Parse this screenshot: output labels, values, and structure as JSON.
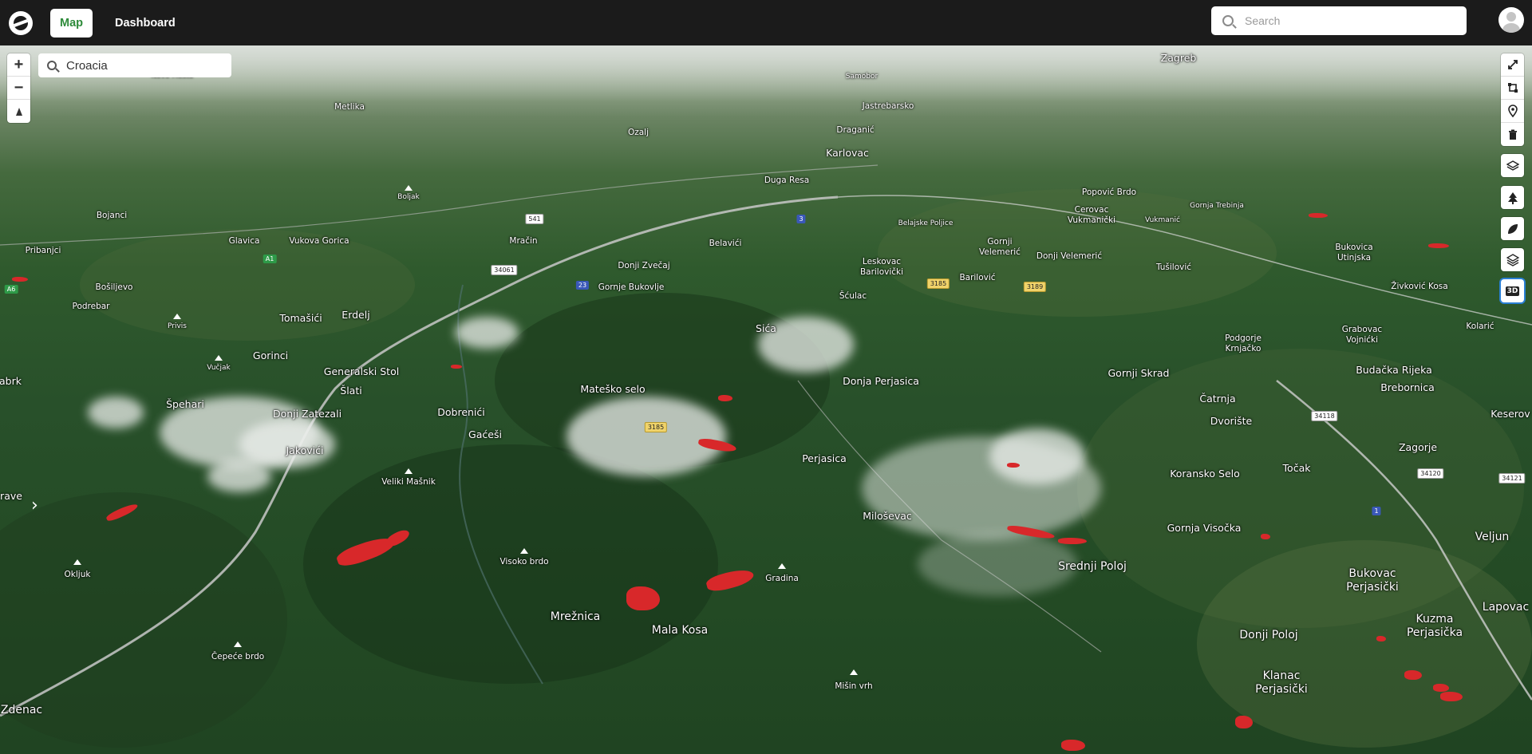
{
  "header": {
    "logo": "app-logo",
    "tabs": [
      {
        "label": "Map",
        "active": true
      },
      {
        "label": "Dashboard",
        "active": false
      }
    ],
    "search_placeholder": "Search"
  },
  "map": {
    "search_value": "Croacia",
    "controls": {
      "zoom_in": "+",
      "zoom_out": "−",
      "expand": "›",
      "three_d": "3D"
    },
    "toolbar_icons": [
      "expand-diagonal-icon",
      "polygon-draw-icon",
      "location-pin-icon",
      "trash-icon",
      "layers-icon",
      "tree-icon",
      "leaf-icon",
      "layers-stack-icon",
      "three-d-icon"
    ],
    "accent_color": "#2e8b3a",
    "fire_color": "#d8282a",
    "places": [
      {
        "name": "Zagreb",
        "size": "m"
      },
      {
        "name": "Karlovac",
        "size": "m"
      },
      {
        "name": "Duga Resa",
        "size": "s"
      },
      {
        "name": "Metlika",
        "size": "s"
      },
      {
        "name": "Novo Mesto",
        "size": "xs"
      },
      {
        "name": "Ozalj",
        "size": "s"
      },
      {
        "name": "Draganić",
        "size": "s"
      },
      {
        "name": "Jastrebarsko",
        "size": "s"
      },
      {
        "name": "Samobor",
        "size": "xs"
      },
      {
        "name": "Mrežnica",
        "size": "l"
      },
      {
        "name": "Mala Kosa",
        "size": "l"
      },
      {
        "name": "Srednji Poloj",
        "size": "l"
      },
      {
        "name": "Bukovac Perjasički",
        "size": "l"
      },
      {
        "name": "Kuzma Perjasička",
        "size": "l"
      },
      {
        "name": "Klanac Perjasički",
        "size": "l"
      },
      {
        "name": "Donji Poloj",
        "size": "l"
      },
      {
        "name": "Lapovac",
        "size": "l"
      },
      {
        "name": "Veljun",
        "size": "l"
      },
      {
        "name": "Gornja Visočka",
        "size": "m"
      },
      {
        "name": "Koransko Selo",
        "size": "m"
      },
      {
        "name": "Točak",
        "size": "m"
      },
      {
        "name": "Zagorje",
        "size": "m"
      },
      {
        "name": "Keserov",
        "size": "m"
      },
      {
        "name": "Dvorište",
        "size": "m"
      },
      {
        "name": "Čatrnja",
        "size": "m"
      },
      {
        "name": "Gornji Skrad",
        "size": "m"
      },
      {
        "name": "Budačka Rijeka",
        "size": "m"
      },
      {
        "name": "Brebornica",
        "size": "m"
      },
      {
        "name": "Perjasica",
        "size": "m"
      },
      {
        "name": "Miloševac",
        "size": "m"
      },
      {
        "name": "Donja Perjasica",
        "size": "m"
      },
      {
        "name": "Sića",
        "size": "m"
      },
      {
        "name": "Mateško selo",
        "size": "m"
      },
      {
        "name": "Dobrenići",
        "size": "m"
      },
      {
        "name": "Gaćeši",
        "size": "m"
      },
      {
        "name": "Generalski Stol",
        "size": "m"
      },
      {
        "name": "Šlati",
        "size": "m"
      },
      {
        "name": "Gorinci",
        "size": "m"
      },
      {
        "name": "Špehari",
        "size": "m"
      },
      {
        "name": "Donji Zatezali",
        "size": "m"
      },
      {
        "name": "Jakovići",
        "size": "m"
      },
      {
        "name": "Tomašići",
        "size": "m"
      },
      {
        "name": "Erdelj",
        "size": "m"
      },
      {
        "name": "Gornje Bukovlje",
        "size": "s"
      },
      {
        "name": "Donji Zvečaj",
        "size": "s"
      },
      {
        "name": "Belavići",
        "size": "s"
      },
      {
        "name": "Mračin",
        "size": "s"
      },
      {
        "name": "Glavica",
        "size": "s"
      },
      {
        "name": "Vukova Gorica",
        "size": "s"
      },
      {
        "name": "Bošiljevo",
        "size": "s"
      },
      {
        "name": "Podrebar",
        "size": "s"
      },
      {
        "name": "Pribanjci",
        "size": "s"
      },
      {
        "name": "Bojanci",
        "size": "s"
      },
      {
        "name": "Leskovac Barilovički",
        "size": "s"
      },
      {
        "name": "Barilović",
        "size": "s"
      },
      {
        "name": "Šćulac",
        "size": "s"
      },
      {
        "name": "Gornji Velemerić",
        "size": "s"
      },
      {
        "name": "Donji Velemerić",
        "size": "s"
      },
      {
        "name": "Cerovac Vukmanički",
        "size": "s"
      },
      {
        "name": "Tušilović",
        "size": "s"
      },
      {
        "name": "Podgorje Krnjačko",
        "size": "s"
      },
      {
        "name": "Grabovac Vojnićki",
        "size": "s"
      },
      {
        "name": "Kolarić",
        "size": "s"
      },
      {
        "name": "Bukovica Utinjska",
        "size": "s"
      },
      {
        "name": "Živković Kosa",
        "size": "s"
      },
      {
        "name": "Popović Brdo",
        "size": "s"
      },
      {
        "name": "Gornja Trebinja",
        "size": "xs"
      },
      {
        "name": "Vukmanić",
        "size": "xs"
      },
      {
        "name": "Belajske Poljice",
        "size": "xs"
      },
      {
        "name": "Zdenac",
        "size": "l"
      },
      {
        "name": "rave",
        "size": "m"
      },
      {
        "name": "abrk",
        "size": "m"
      }
    ],
    "peaks": [
      "Veliki Mašnik",
      "Visoko brdo",
      "Gradina",
      "Mišin vrh",
      "Čepeće brdo",
      "Okljuk",
      "Privis",
      "Vučjak",
      "Boljak"
    ],
    "road_shields": [
      "3185",
      "34118",
      "34120",
      "34121",
      "34061",
      "3189",
      "3185",
      "A1",
      "1",
      "3",
      "541",
      "23",
      "A6"
    ]
  }
}
